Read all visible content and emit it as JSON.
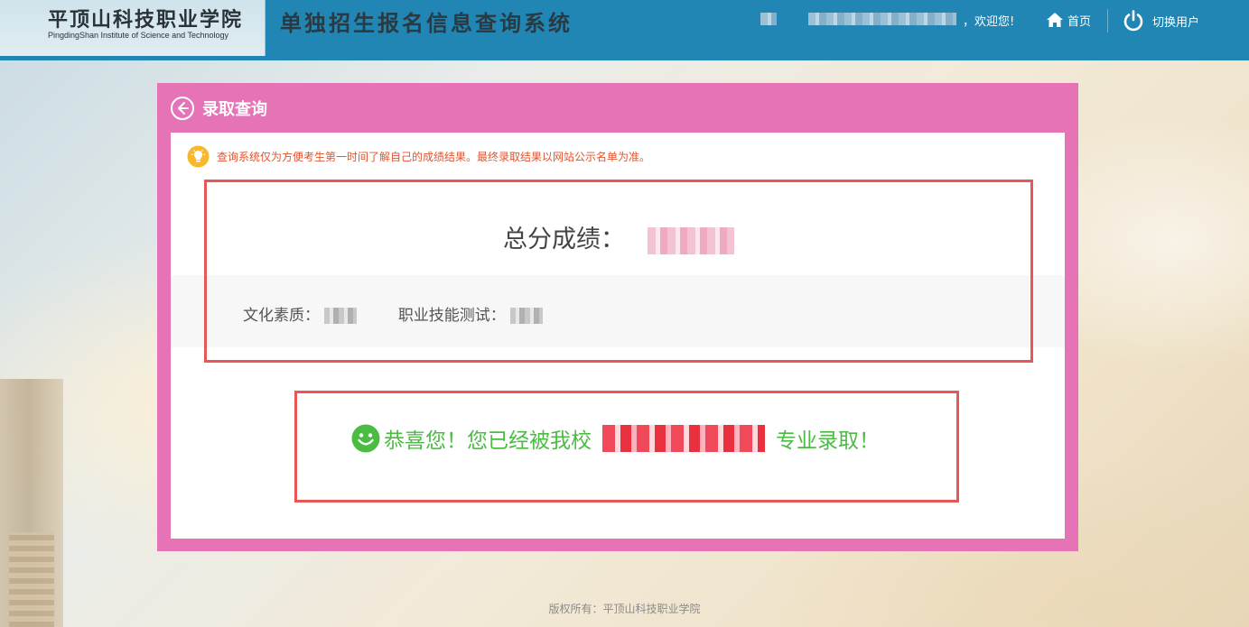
{
  "header": {
    "school_name_cn": "平顶山科技职业学院",
    "school_name_en": "PingdingShan Institute of Science and Technology",
    "system_title": "单独招生报名信息查询系统",
    "welcome_text": "，欢迎您!",
    "home_label": "首页",
    "switch_user_label": "切换用户"
  },
  "card": {
    "title": "录取查询",
    "notice": "查询系统仅为方便考生第一时间了解自己的成绩结果。最终录取结果以网站公示名单为准。",
    "total_score_label": "总分成绩：",
    "culture_label": "文化素质：",
    "skill_label": "职业技能测试：",
    "admit_prefix": "恭喜您！您已经被我校",
    "admit_suffix": "专业录取！"
  },
  "footer": {
    "copyright": "版权所有：平顶山科技职业学院"
  },
  "colors": {
    "header_bg": "#2286b4",
    "card_bg": "#e673b6",
    "highlight_border": "#e85656",
    "notice_text": "#e0552f",
    "success_green": "#4cbb44",
    "notice_icon": "#f5b82e"
  }
}
